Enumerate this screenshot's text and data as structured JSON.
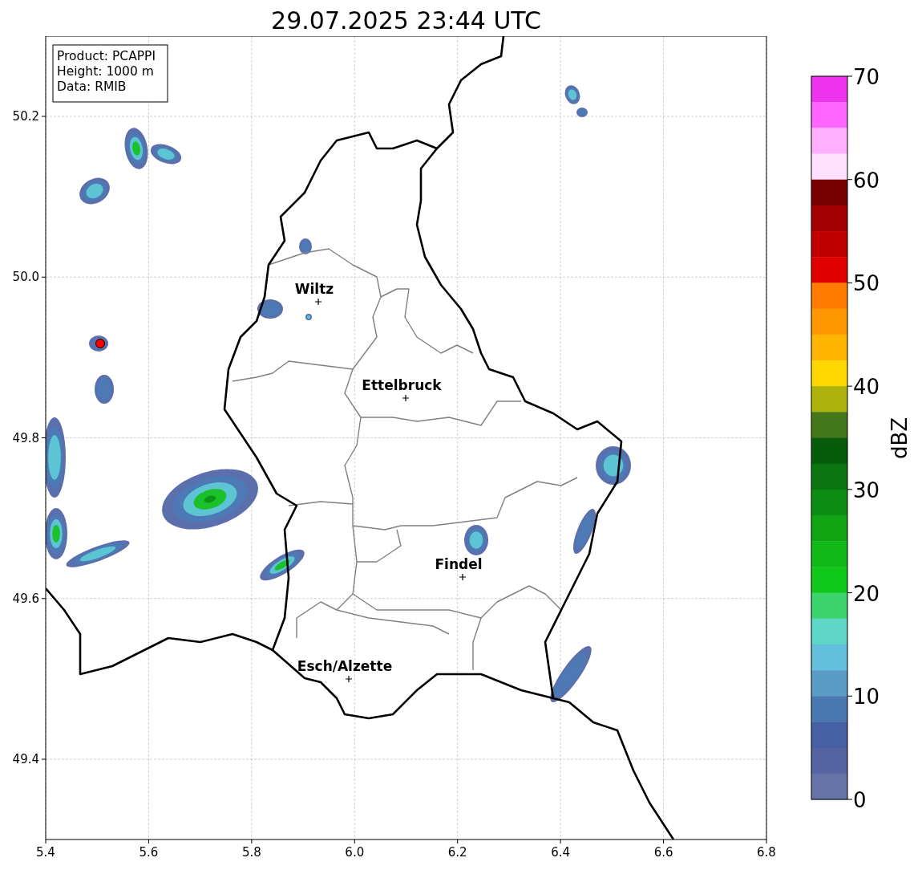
{
  "title": "29.07.2025 23:44 UTC",
  "map": {
    "info_lines": [
      "Product: PCAPPI",
      "Height: 1000 m",
      "Data: RMIB"
    ],
    "xticks": [
      "5.4",
      "5.6",
      "5.8",
      "6.0",
      "6.2",
      "6.4",
      "6.6",
      "6.8"
    ],
    "yticks": [
      "50.2",
      "50.0",
      "49.8",
      "49.6",
      "49.4"
    ],
    "cities": [
      {
        "name": "Wiltz"
      },
      {
        "name": "Ettelbruck"
      },
      {
        "name": "Findel"
      },
      {
        "name": "Esch/Alzette"
      }
    ]
  },
  "colorbar": {
    "label": "dBZ",
    "ticks": [
      "70",
      "60",
      "50",
      "40",
      "30",
      "20",
      "10",
      "0"
    ],
    "bands": [
      {
        "color": "#ee33ee"
      },
      {
        "color": "#ff66ff"
      },
      {
        "color": "#ffb0ff"
      },
      {
        "color": "#ffe0ff"
      },
      {
        "color": "#780000"
      },
      {
        "color": "#a00000"
      },
      {
        "color": "#c00000"
      },
      {
        "color": "#e00000"
      },
      {
        "color": "#ff7c00"
      },
      {
        "color": "#ff9800"
      },
      {
        "color": "#ffb400"
      },
      {
        "color": "#fed800"
      },
      {
        "color": "#acb20a"
      },
      {
        "color": "#44761a"
      },
      {
        "color": "#065c0a"
      },
      {
        "color": "#0a7410"
      },
      {
        "color": "#0c8c10"
      },
      {
        "color": "#10a412"
      },
      {
        "color": "#10b818"
      },
      {
        "color": "#10c81a"
      },
      {
        "color": "#3cd46c"
      },
      {
        "color": "#5ed6c8"
      },
      {
        "color": "#64bfdc"
      },
      {
        "color": "#5a9cc6"
      },
      {
        "color": "#4a78b0"
      },
      {
        "color": "#4560a3"
      },
      {
        "color": "#5464a0"
      },
      {
        "color": "#6673a6"
      }
    ]
  }
}
